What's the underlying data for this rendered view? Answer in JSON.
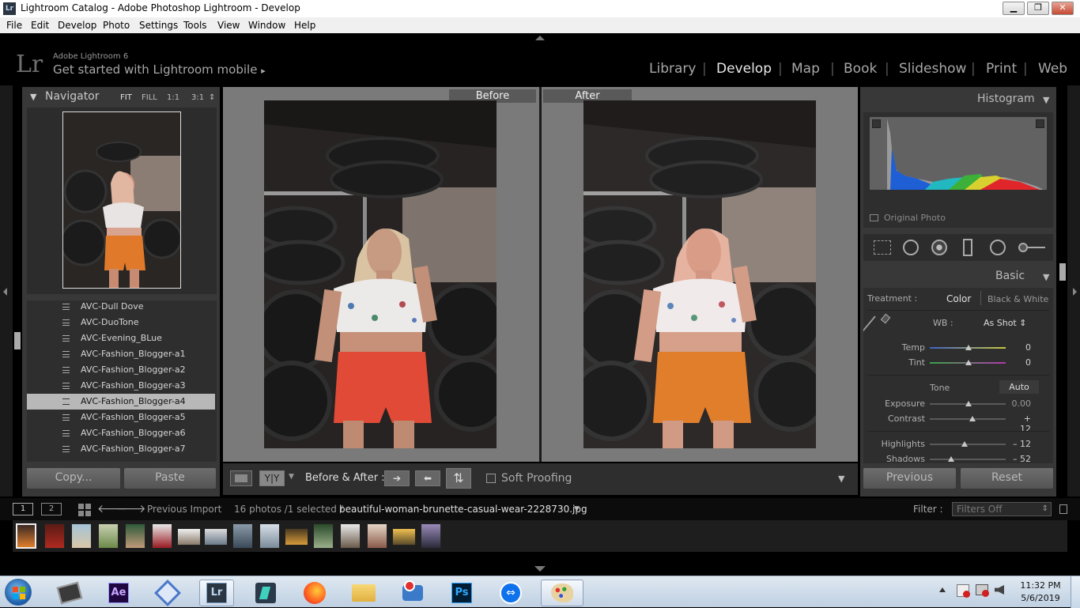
{
  "window": {
    "app_icon": "Lr",
    "title": "Lightroom Catalog - Adobe Photoshop Lightroom - Develop",
    "minimize": "▁",
    "restore": "❐",
    "close": "✕"
  },
  "menu": [
    "File",
    "Edit",
    "Develop",
    "Photo",
    "Settings",
    "Tools",
    "View",
    "Window",
    "Help"
  ],
  "identity": {
    "logo": "Lr",
    "product": "Adobe Lightroom 6",
    "mobile_prompt": "Get started with Lightroom mobile",
    "mobile_arrow": "▸"
  },
  "modules": [
    "Library",
    "Develop",
    "Map",
    "Book",
    "Slideshow",
    "Print",
    "Web"
  ],
  "active_module": "Develop",
  "navigator": {
    "title": "Navigator",
    "collapse": "▼",
    "zoom": [
      "FIT",
      "FILL",
      "1:1",
      "3:1"
    ],
    "zoom_more": "⇕"
  },
  "presets": [
    "AVC-Dull Dove",
    "AVC-DuoTone",
    "AVC-Evening_BLue",
    "AVC-Fashion_Blogger-a1",
    "AVC-Fashion_Blogger-a2",
    "AVC-Fashion_Blogger-a3",
    "AVC-Fashion_Blogger-a4",
    "AVC-Fashion_Blogger-a5",
    "AVC-Fashion_Blogger-a6",
    "AVC-Fashion_Blogger-a7"
  ],
  "selected_preset": "AVC-Fashion_Blogger-a4",
  "left_buttons": {
    "copy": "Copy...",
    "paste": "Paste"
  },
  "compare": {
    "before": "Before",
    "after": "After"
  },
  "toolbar": {
    "before_after_label": "Before & After :",
    "yy": "Y|Y",
    "soft_proofing": "Soft Proofing",
    "arrow_right": "➔",
    "arrow_left": "⬅",
    "swap": "⇅",
    "menu": "▼"
  },
  "histogram": {
    "title": "Histogram",
    "original_photo": "Original Photo"
  },
  "basic": {
    "title": "Basic",
    "treatment_label": "Treatment :",
    "color": "Color",
    "bw": "Black & White",
    "wb_label": "WB :",
    "wb_value": "As Shot ⇕",
    "temp_label": "Temp",
    "temp_value": "0",
    "tint_label": "Tint",
    "tint_value": "0",
    "tone_label": "Tone",
    "auto": "Auto",
    "exposure_label": "Exposure",
    "exposure_value": "0.00",
    "contrast_label": "Contrast",
    "contrast_value": "+ 12",
    "highlights_label": "Highlights",
    "highlights_value": "– 12",
    "shadows_label": "Shadows",
    "shadows_value": "– 52"
  },
  "right_buttons": {
    "previous": "Previous",
    "reset": "Reset"
  },
  "filmstrip_bar": {
    "screen1": "1",
    "screen2": "2",
    "source": "Previous Import",
    "count": "16 photos /1 selected /",
    "filename": "beautiful-woman-brunette-casual-wear-2228730.jpg",
    "filename_arrow": "▼",
    "filter_label": "Filter :",
    "filter_value": "Filters Off",
    "filter_arrow": "⇕",
    "nav_back": "🡐",
    "nav_fwd": "🡒"
  },
  "taskbar": {
    "time": "11:32 PM",
    "date": "5/6/2019",
    "apps": [
      "Windows Start",
      "Video Editor",
      "After Effects",
      "Network App",
      "Lightroom",
      "Filmora",
      "Firefox",
      "File Explorer",
      "Camera App",
      "Photoshop",
      "TeamViewer",
      "Paint"
    ],
    "ae": "Ae",
    "lr": "Lr",
    "ps": "Ps"
  },
  "colors": {
    "panel": "#383838",
    "center_bg": "#7a7a7a",
    "selected_preset": "#b8b8b8",
    "shorts_before": "#e04a36",
    "shorts_after": "#e07e2c"
  }
}
